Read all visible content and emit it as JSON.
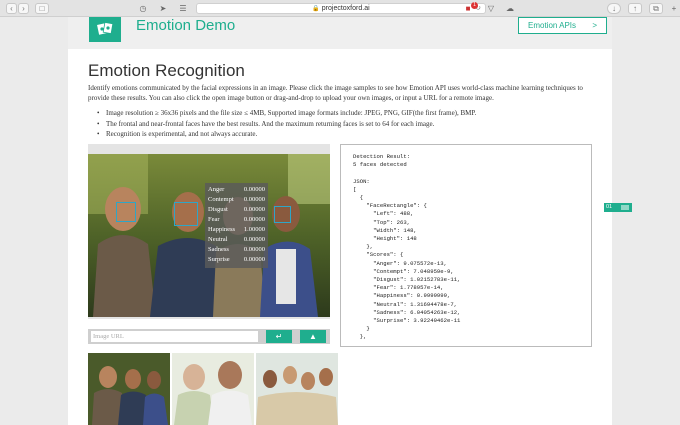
{
  "browser": {
    "url": "projectoxford.ai",
    "adblock_count": "1"
  },
  "header": {
    "brand": "Emotion Demo",
    "api_button": "Emotion APIs",
    "api_arrow": ">"
  },
  "main": {
    "title": "Emotion Recognition",
    "description": "Identify emotions communicated by the facial expressions in an image. Please click the image samples to see how Emotion API uses world-class machine learning techniques to provide these results. You can also click the open image button or drag-and-drop to upload your own images, or input a URL for a remote image.",
    "bullets": [
      "Image resolution ≥ 36x36 pixels and the file size ≤ 4MB, Supported image formats include: JPEG, PNG, GIF(the first frame), BMP.",
      "The frontal and near-frontal faces have the best results. And the maximum returning faces is set to 64 for each image.",
      "Recognition is experimental, and not always accurate."
    ]
  },
  "scores": [
    {
      "label": "Anger",
      "value": "0.00000"
    },
    {
      "label": "Contempt",
      "value": "0.00000"
    },
    {
      "label": "Disgust",
      "value": "0.00000"
    },
    {
      "label": "Fear",
      "value": "0.00000"
    },
    {
      "label": "Happiness",
      "value": "1.00000"
    },
    {
      "label": "Neutral",
      "value": "0.00000"
    },
    {
      "label": "Sadness",
      "value": "0.00000"
    },
    {
      "label": "Surprise",
      "value": "0.00000"
    }
  ],
  "url_input": {
    "placeholder": "Image URL",
    "submit_icon": "enter-icon",
    "open_icon": "folder-open-icon"
  },
  "result": {
    "text": "Detection Result:\n5 faces detected\n\nJSON:\n[\n  {\n    \"FaceRectangle\": {\n      \"Left\": 488,\n      \"Top\": 263,\n      \"Width\": 148,\n      \"Height\": 148\n    },\n    \"Scores\": {\n      \"Anger\": 9.075572e-13,\n      \"Contempt\": 7.048959e-9,\n      \"Disgust\": 1.02152783e-11,\n      \"Fear\": 1.778957e-14,\n      \"Happiness\": 0.9999999,\n      \"Neutral\": 1.31694478e-7,\n      \"Sadness\": 6.04054263e-12,\n      \"Surprise\": 3.92249462e-11\n    }\n  },"
  },
  "side_tab": {
    "label": "01"
  },
  "colors": {
    "accent": "#1fae8e",
    "face_box": "#2ea6c7"
  }
}
